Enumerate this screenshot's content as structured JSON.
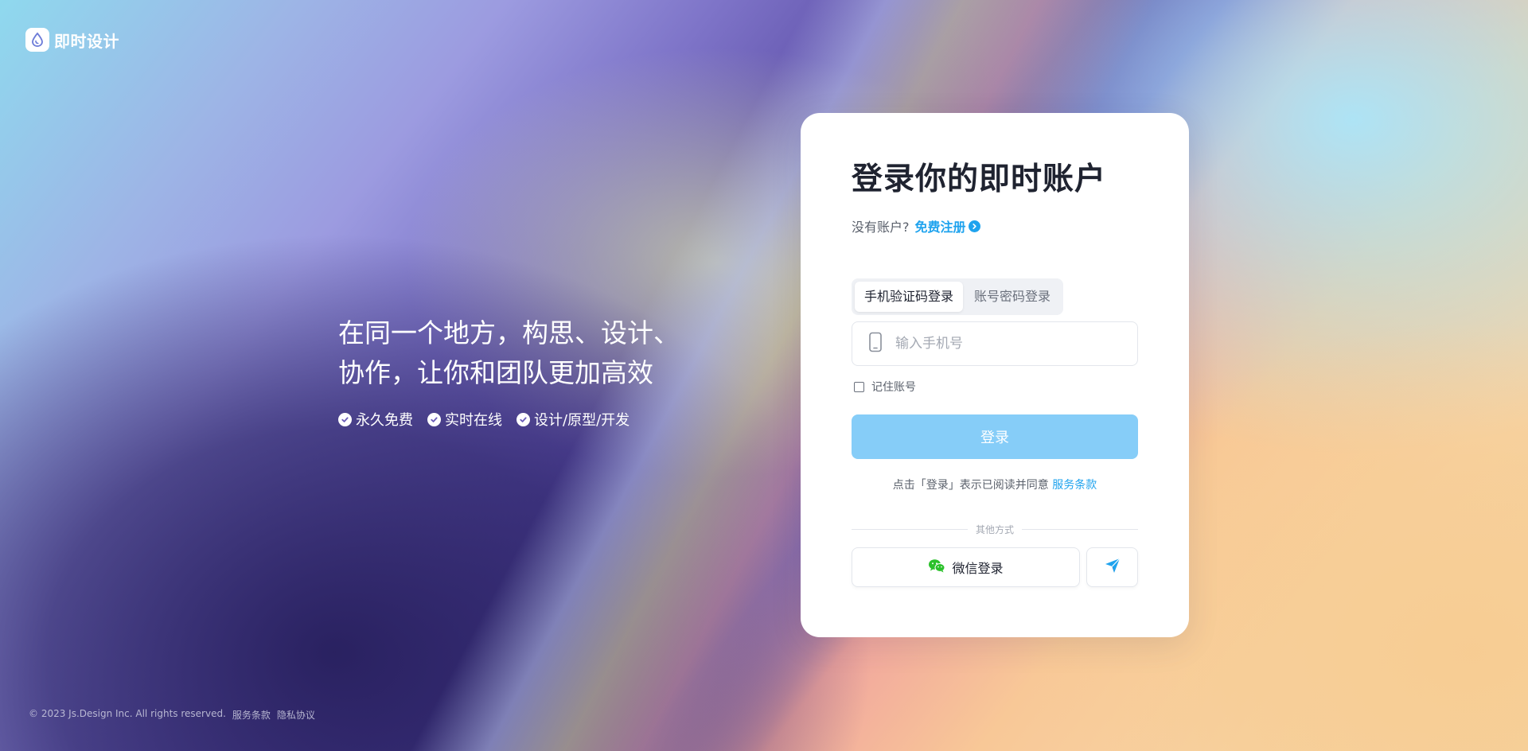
{
  "logo": {
    "text": "即时设计",
    "icon": "droplet-icon"
  },
  "hero": {
    "line1": "在同一个地方，构思、设计、",
    "line2": "协作，让你和团队更加高效",
    "features": [
      {
        "icon": "check-circle-icon",
        "label": "永久免费"
      },
      {
        "icon": "check-circle-icon",
        "label": "实时在线"
      },
      {
        "icon": "check-circle-icon",
        "label": "设计/原型/开发"
      }
    ]
  },
  "card": {
    "title": "登录你的即时账户",
    "no_account": "没有账户?",
    "signup_link": "免费注册",
    "tabs": [
      {
        "label": "手机验证码登录",
        "active": true
      },
      {
        "label": "账号密码登录",
        "active": false
      }
    ],
    "phone_placeholder": "输入手机号",
    "phone_value": "",
    "remember_label": "记住账号",
    "remember_checked": false,
    "login_button": "登录",
    "terms_text": "点击「登录」表示已阅读并同意",
    "terms_link": "服务条款",
    "other_methods": "其他方式",
    "wechat_button": "微信登录"
  },
  "footer": {
    "copyright": "© 2023 Js.Design Inc. All rights reserved.",
    "terms": "服务条款",
    "privacy": "隐私协议"
  },
  "colors": {
    "accent": "#1fa3ee",
    "login_button_bg": "#86cdf8",
    "wechat_green": "#2bc12b",
    "title_text": "#1f2330"
  }
}
